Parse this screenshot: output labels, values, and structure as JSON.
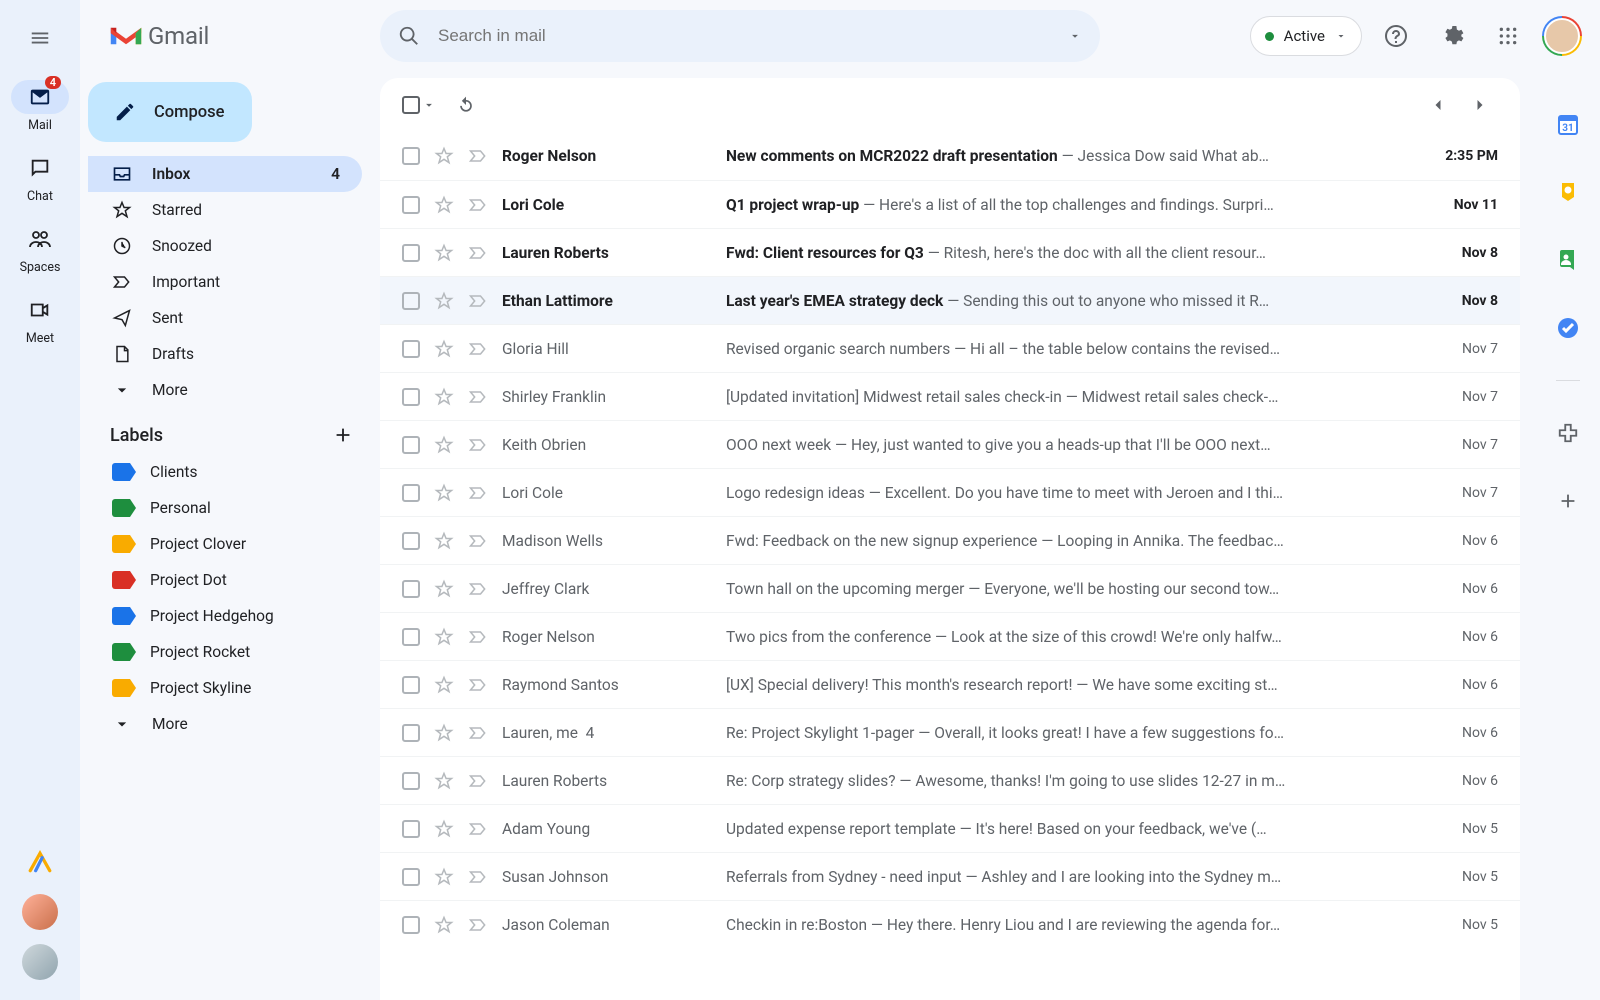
{
  "app_name": "Gmail",
  "search": {
    "placeholder": "Search in mail"
  },
  "status": {
    "label": "Active"
  },
  "rail": {
    "items": [
      {
        "label": "Mail",
        "badge": "4"
      },
      {
        "label": "Chat"
      },
      {
        "label": "Spaces"
      },
      {
        "label": "Meet"
      }
    ]
  },
  "compose_label": "Compose",
  "nav": {
    "items": [
      {
        "label": "Inbox",
        "count": "4"
      },
      {
        "label": "Starred"
      },
      {
        "label": "Snoozed"
      },
      {
        "label": "Important"
      },
      {
        "label": "Sent"
      },
      {
        "label": "Drafts"
      },
      {
        "label": "More"
      }
    ]
  },
  "labels_header": "Labels",
  "labels": [
    {
      "name": "Clients",
      "color": "#1a73e8"
    },
    {
      "name": "Personal",
      "color": "#1e8e3e"
    },
    {
      "name": "Project Clover",
      "color": "#f9ab00"
    },
    {
      "name": "Project Dot",
      "color": "#d93025"
    },
    {
      "name": "Project Hedgehog",
      "color": "#1a73e8"
    },
    {
      "name": "Project Rocket",
      "color": "#1e8e3e"
    },
    {
      "name": "Project Skyline",
      "color": "#f9ab00"
    }
  ],
  "labels_more": "More",
  "emails": [
    {
      "sender": "Roger Nelson",
      "subject": "New comments on MCR2022 draft presentation",
      "snippet": "Jessica Dow said What ab…",
      "time": "2:35 PM",
      "unread": true
    },
    {
      "sender": "Lori Cole",
      "subject": "Q1 project wrap-up",
      "snippet": "Here's a list of all the top challenges and findings. Surpri…",
      "time": "Nov 11",
      "unread": true
    },
    {
      "sender": "Lauren Roberts",
      "subject": "Fwd: Client resources for Q3",
      "snippet": "Ritesh, here's the doc with all the client resour…",
      "time": "Nov 8",
      "unread": true
    },
    {
      "sender": "Ethan Lattimore",
      "subject": "Last year's EMEA strategy deck",
      "snippet": "Sending this out to anyone who missed it R…",
      "time": "Nov 8",
      "unread": true
    },
    {
      "sender": "Gloria Hill",
      "subject": "Revised organic search numbers",
      "snippet": "Hi all – the table below contains the revised…",
      "time": "Nov 7",
      "unread": false
    },
    {
      "sender": "Shirley Franklin",
      "subject": "[Updated invitation] Midwest retail sales check-in",
      "snippet": "Midwest retail sales check-…",
      "time": "Nov 7",
      "unread": false
    },
    {
      "sender": "Keith Obrien",
      "subject": "OOO next week",
      "snippet": "Hey, just wanted to give you a heads-up that I'll be OOO next…",
      "time": "Nov 7",
      "unread": false
    },
    {
      "sender": "Lori Cole",
      "subject": "Logo redesign ideas",
      "snippet": "Excellent. Do you have time to meet with Jeroen and I thi…",
      "time": "Nov 7",
      "unread": false
    },
    {
      "sender": "Madison Wells",
      "subject": "Fwd: Feedback on the new signup experience",
      "snippet": "Looping in Annika. The feedbac…",
      "time": "Nov 6",
      "unread": false
    },
    {
      "sender": "Jeffrey Clark",
      "subject": "Town hall on the upcoming merger",
      "snippet": "Everyone, we'll be hosting our second tow…",
      "time": "Nov 6",
      "unread": false
    },
    {
      "sender": "Roger Nelson",
      "subject": "Two pics from the conference",
      "snippet": "Look at the size of this crowd! We're only halfw…",
      "time": "Nov 6",
      "unread": false
    },
    {
      "sender": "Raymond Santos",
      "subject": "[UX] Special delivery! This month's research report!",
      "snippet": "We have some exciting st…",
      "time": "Nov 6",
      "unread": false
    },
    {
      "sender": "Lauren, me",
      "thread_count": "4",
      "subject": "Re: Project Skylight 1-pager",
      "snippet": "Overall, it looks great! I have a few suggestions fo…",
      "time": "Nov 6",
      "unread": false
    },
    {
      "sender": "Lauren Roberts",
      "subject": "Re: Corp strategy slides?",
      "snippet": "Awesome, thanks! I'm going to use slides 12-27 in m…",
      "time": "Nov 6",
      "unread": false
    },
    {
      "sender": "Adam Young",
      "subject": "Updated expense report template",
      "snippet": "It's here! Based on your feedback, we've (…",
      "time": "Nov 5",
      "unread": false
    },
    {
      "sender": "Susan Johnson",
      "subject": "Referrals from Sydney - need input",
      "snippet": "Ashley and I are looking into the Sydney m…",
      "time": "Nov 5",
      "unread": false
    },
    {
      "sender": "Jason Coleman",
      "subject": "Checkin in re:Boston",
      "snippet": "Hey there. Henry Liou and I are reviewing the agenda for…",
      "time": "Nov 5",
      "unread": false
    }
  ]
}
